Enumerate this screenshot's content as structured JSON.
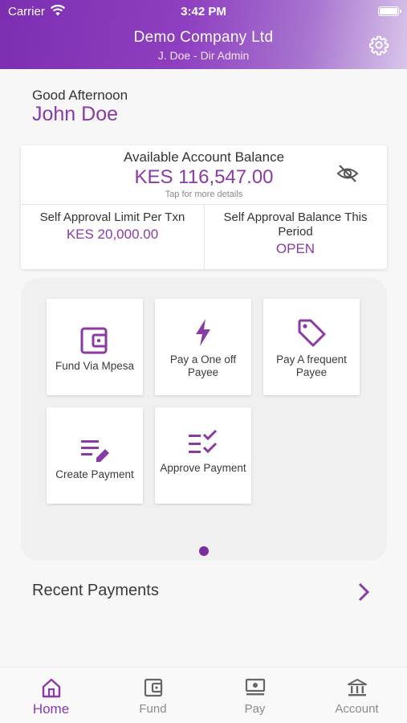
{
  "status_bar": {
    "carrier": "Carrier",
    "time": "3:42 PM"
  },
  "header": {
    "company": "Demo Company Ltd",
    "user_role": "J. Doe - Dir Admin"
  },
  "greeting": {
    "salutation": "Good Afternoon",
    "name": "John Doe"
  },
  "balance_card": {
    "label": "Available Account Balance",
    "amount": "KES 116,547.00",
    "hint": "Tap for more details",
    "limit_label": "Self Approval Limit Per Txn",
    "limit_value": "KES 20,000.00",
    "period_label": "Self Approval Balance This Period",
    "period_value": "OPEN"
  },
  "actions": [
    {
      "label": "Fund Via Mpesa",
      "icon": "wallet-icon"
    },
    {
      "label": "Pay a One off Payee",
      "icon": "lightning-icon"
    },
    {
      "label": "Pay A frequent Payee",
      "icon": "tag-icon"
    },
    {
      "label": "Create Payment",
      "icon": "edit-list-icon"
    },
    {
      "label": "Approve Payment",
      "icon": "checklist-icon"
    }
  ],
  "recent_payments": {
    "label": "Recent Payments"
  },
  "tabs": [
    {
      "label": "Home",
      "icon": "home-icon",
      "active": true
    },
    {
      "label": "Fund",
      "icon": "wallet-icon"
    },
    {
      "label": "Pay",
      "icon": "cash-icon"
    },
    {
      "label": "Account",
      "icon": "bank-icon"
    }
  ],
  "colors": {
    "accent": "#8a3aa5",
    "header_start": "#7b2fb0",
    "header_end": "#d9c5ea"
  }
}
